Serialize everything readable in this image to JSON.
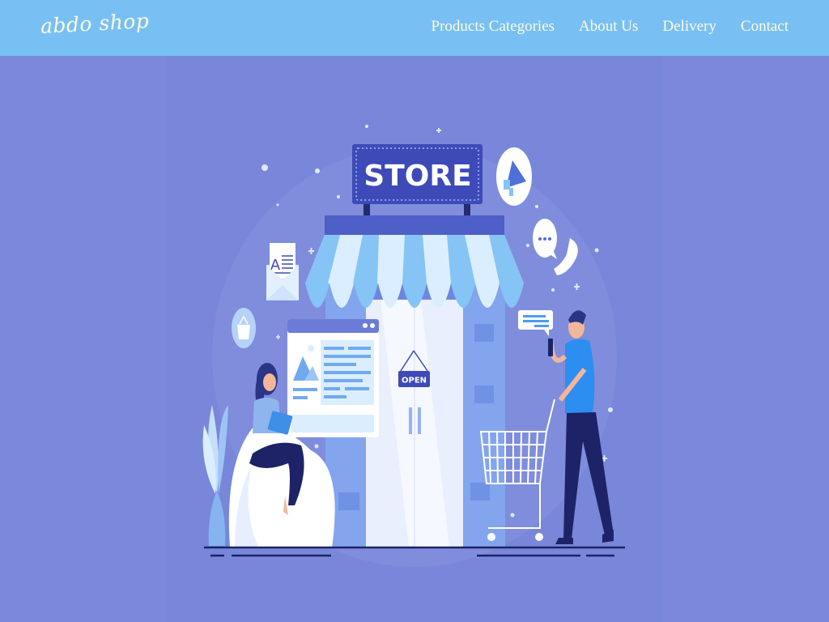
{
  "brand": {
    "logo_text": "abdo shop"
  },
  "nav": {
    "items": [
      {
        "label": "Products Categories"
      },
      {
        "label": "About Us"
      },
      {
        "label": "Delivery"
      },
      {
        "label": "Contact"
      }
    ]
  },
  "hero": {
    "store_sign": "STORE",
    "open_sign": "OPEN",
    "newsletter_letter": "A"
  },
  "colors": {
    "navbar": "#78c0f4",
    "page_background": "#7b88dc",
    "nav_text": "#fefbe0",
    "sign_blue": "#3d4ab8"
  }
}
